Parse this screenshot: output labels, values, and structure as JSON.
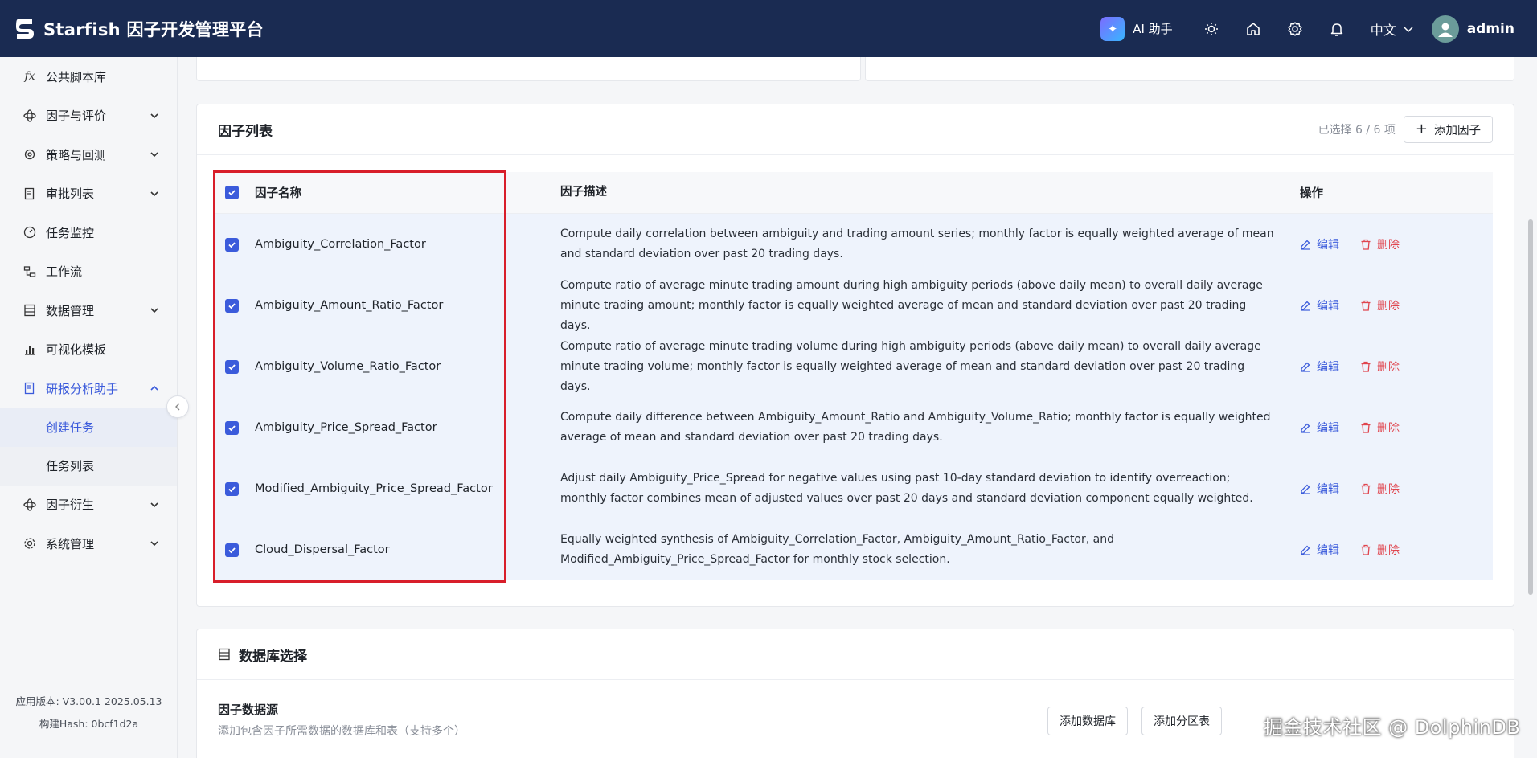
{
  "header": {
    "title": "Starfish 因子开发管理平台",
    "ai_label": "AI 助手",
    "language": "中文",
    "username": "admin"
  },
  "sidebar": {
    "items": [
      {
        "label": "公共脚本库",
        "icon": "fx-icon",
        "has_chevron": false
      },
      {
        "label": "因子与评价",
        "icon": "atom-icon",
        "has_chevron": true
      },
      {
        "label": "策略与回测",
        "icon": "gear-spark-icon",
        "has_chevron": true
      },
      {
        "label": "审批列表",
        "icon": "doc-check-icon",
        "has_chevron": true
      },
      {
        "label": "任务监控",
        "icon": "dashboard-icon",
        "has_chevron": false
      },
      {
        "label": "工作流",
        "icon": "workflow-icon",
        "has_chevron": false
      },
      {
        "label": "数据管理",
        "icon": "list-icon",
        "has_chevron": true
      },
      {
        "label": "可视化模板",
        "icon": "chart-icon",
        "has_chevron": false
      },
      {
        "label": "研报分析助手",
        "icon": "report-icon",
        "has_chevron": true,
        "expanded": true
      }
    ],
    "sub_items": [
      "创建任务",
      "任务列表"
    ],
    "items_after": [
      {
        "label": "因子衍生",
        "icon": "atom-icon",
        "has_chevron": true
      },
      {
        "label": "系统管理",
        "icon": "gear-icon",
        "has_chevron": true
      }
    ],
    "version": "应用版本: V3.00.1 2025.05.13",
    "build_hash": "构建Hash: 0bcf1d2a"
  },
  "factor_list": {
    "title": "因子列表",
    "selected_text": "已选择 6 / 6 项",
    "add_button": "添加因子",
    "columns": {
      "name": "因子名称",
      "desc": "因子描述",
      "ops": "操作"
    },
    "edit_label": "编辑",
    "delete_label": "删除",
    "rows": [
      {
        "name": "Ambiguity_Correlation_Factor",
        "desc": "Compute daily correlation between ambiguity and trading amount series; monthly factor is equally weighted average of mean and standard deviation over past 20 trading days."
      },
      {
        "name": "Ambiguity_Amount_Ratio_Factor",
        "desc": "Compute ratio of average minute trading amount during high ambiguity periods (above daily mean) to overall daily average minute trading amount; monthly factor is equally weighted average of mean and standard deviation over past 20 trading days."
      },
      {
        "name": "Ambiguity_Volume_Ratio_Factor",
        "desc": "Compute ratio of average minute trading volume during high ambiguity periods (above daily mean) to overall daily average minute trading volume; monthly factor is equally weighted average of mean and standard deviation over past 20 trading days."
      },
      {
        "name": "Ambiguity_Price_Spread_Factor",
        "desc": "Compute daily difference between Ambiguity_Amount_Ratio and Ambiguity_Volume_Ratio; monthly factor is equally weighted average of mean and standard deviation over past 20 trading days."
      },
      {
        "name": "Modified_Ambiguity_Price_Spread_Factor",
        "desc": "Adjust daily Ambiguity_Price_Spread for negative values using past 10-day standard deviation to identify overreaction; monthly factor combines mean of adjusted values over past 20 days and standard deviation component equally weighted."
      },
      {
        "name": "Cloud_Dispersal_Factor",
        "desc": "Equally weighted synthesis of Ambiguity_Correlation_Factor, Ambiguity_Amount_Ratio_Factor, and Modified_Ambiguity_Price_Spread_Factor for monthly stock selection."
      }
    ]
  },
  "database": {
    "title": "数据库选择",
    "source_title": "因子数据源",
    "source_sub": "添加包含因子所需数据的数据库和表（支持多个）",
    "btn1": "添加数据库",
    "btn2": "添加分区表"
  },
  "watermark": "掘金技术社区 @ DolphinDB",
  "colors": {
    "header_bg": "#1a2b52",
    "accent": "#3b5bdb",
    "danger": "#e0454e",
    "highlight": "#d81e2a"
  }
}
